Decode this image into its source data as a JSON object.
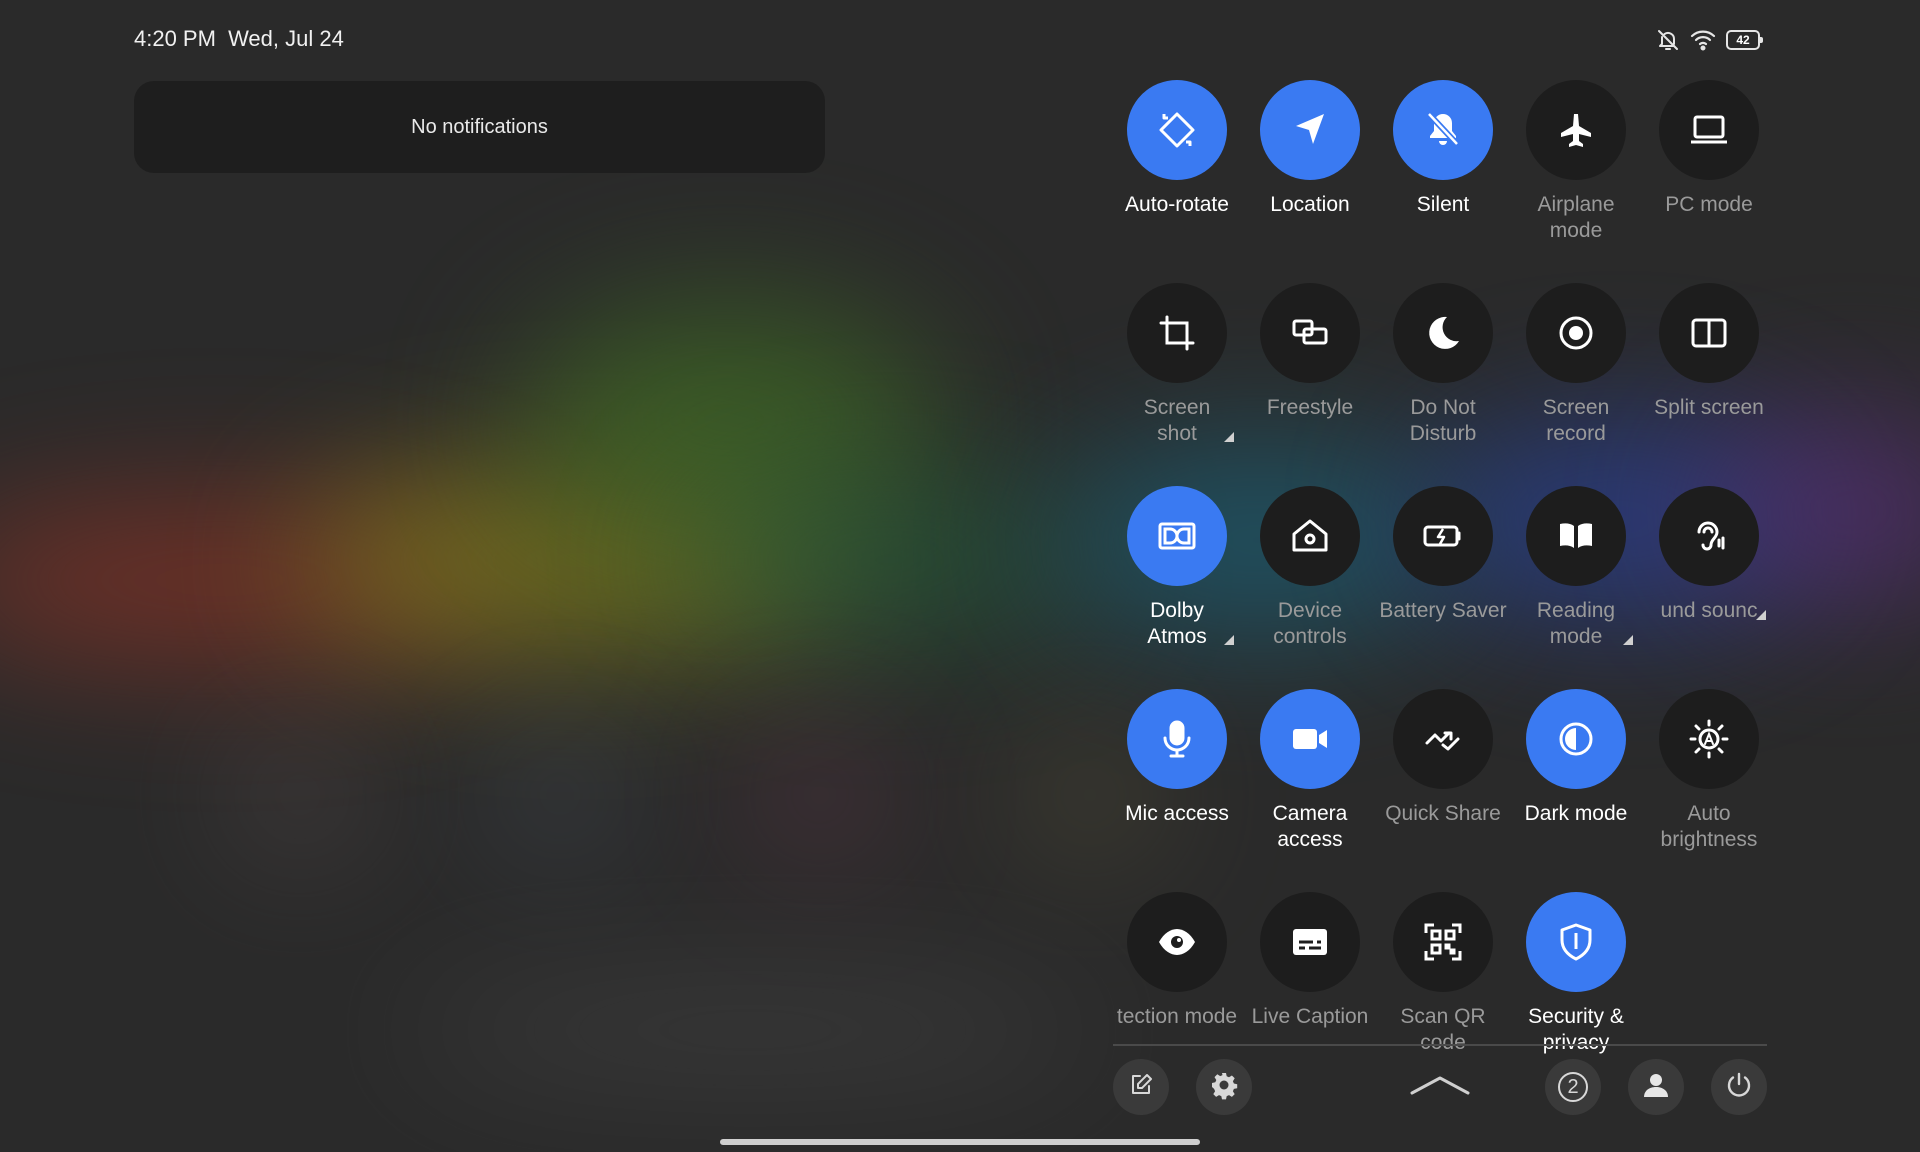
{
  "status_bar": {
    "time": "4:20 PM",
    "date": "Wed, Jul 24",
    "battery_level": "42",
    "icons": [
      "mute-icon",
      "wifi-icon",
      "battery-icon"
    ]
  },
  "notifications": {
    "empty_text": "No notifications"
  },
  "colors": {
    "accent": "#3a7af2",
    "tile_off": "#1d1d1d",
    "label_off": "#9a9a9a"
  },
  "quick_settings": {
    "tiles": [
      {
        "label": "Auto-rotate",
        "icon": "auto-rotate-icon",
        "active": true
      },
      {
        "label": "Location",
        "icon": "location-icon",
        "active": true
      },
      {
        "label": "Silent",
        "icon": "silent-icon",
        "active": true
      },
      {
        "label": "Airplane\nmode",
        "icon": "airplane-icon",
        "active": false
      },
      {
        "label": "PC mode",
        "icon": "pc-mode-icon",
        "active": false
      },
      {
        "label": "Screen\nshot",
        "icon": "screenshot-icon",
        "active": false,
        "has_menu": true
      },
      {
        "label": "Freestyle",
        "icon": "freestyle-icon",
        "active": false
      },
      {
        "label": "Do Not\nDisturb",
        "icon": "moon-icon",
        "active": false
      },
      {
        "label": "Screen\nrecord",
        "icon": "screen-record-icon",
        "active": false
      },
      {
        "label": "Split screen",
        "icon": "split-screen-icon",
        "active": false
      },
      {
        "label": "Dolby\nAtmos",
        "icon": "dolby-icon",
        "active": true,
        "has_menu": true
      },
      {
        "label": "Device\ncontrols",
        "icon": "home-icon",
        "active": false
      },
      {
        "label": "Battery Saver",
        "icon": "battery-saver-icon",
        "active": false
      },
      {
        "label": "Reading\nmode",
        "icon": "book-icon",
        "active": false,
        "has_menu": true
      },
      {
        "label": "und sounc",
        "icon": "hearing-icon",
        "active": false,
        "has_menu": true
      },
      {
        "label": "Mic access",
        "icon": "mic-icon",
        "active": true
      },
      {
        "label": "Camera\naccess",
        "icon": "camera-icon",
        "active": true
      },
      {
        "label": "Quick Share",
        "icon": "quick-share-icon",
        "active": false
      },
      {
        "label": "Dark mode",
        "icon": "dark-mode-icon",
        "active": true
      },
      {
        "label": "Auto\nbrightness",
        "icon": "auto-brightness-icon",
        "active": false
      },
      {
        "label": "tection mode",
        "icon": "eye-icon",
        "active": false
      },
      {
        "label": "Live Caption",
        "icon": "caption-icon",
        "active": false
      },
      {
        "label": "Scan QR\ncode",
        "icon": "qr-icon",
        "active": false
      },
      {
        "label": "Security &\nprivacy",
        "icon": "shield-icon",
        "active": true
      }
    ]
  },
  "bottom_bar": {
    "buttons": [
      "edit-icon",
      "settings-icon",
      "collapse-icon",
      "page-2-icon",
      "user-icon",
      "power-icon"
    ],
    "page_number": "2"
  }
}
